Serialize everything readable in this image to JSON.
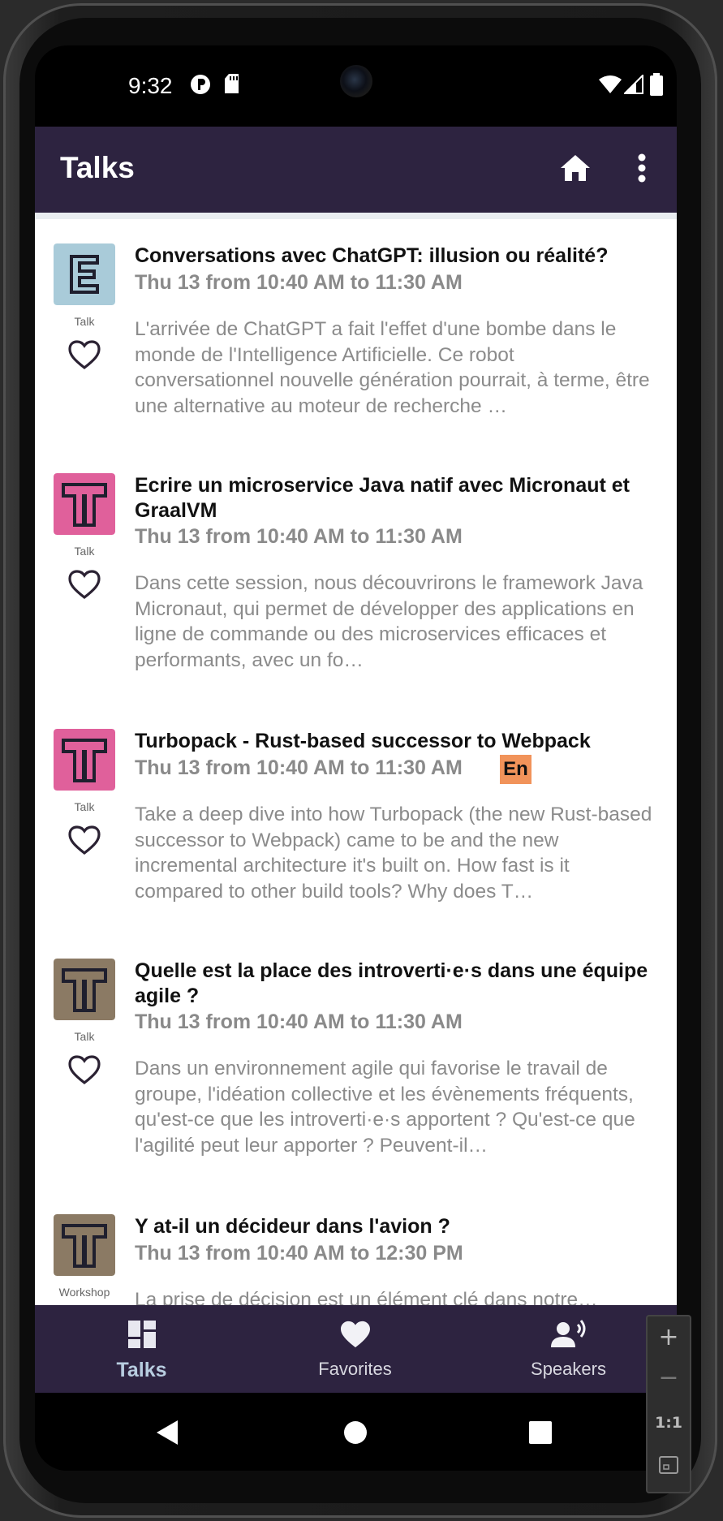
{
  "status_bar": {
    "time": "9:32"
  },
  "app_bar": {
    "title": "Talks"
  },
  "talks": [
    {
      "title": "Conversations avec ChatGPT: illusion ou réalité?",
      "time": "Thu 13 from 10:40 AM to 11:30 AM",
      "kind": "Talk",
      "icon_letter": "E",
      "icon_color": "#a9cbd9",
      "description": "L'arrivée de ChatGPT a fait l'effet d'une bombe dans le monde de l'Intelligence Artificielle. Ce robot conversationnel nouvelle génération pourrait, à terme, être une alternative au moteur de recherche …"
    },
    {
      "title": "Ecrire un microservice Java natif avec Micronaut et GraalVM",
      "time": "Thu 13 from 10:40 AM to 11:30 AM",
      "kind": "Talk",
      "icon_letter": "T",
      "icon_color": "#e0609b",
      "description": "Dans cette session, nous découvrirons le framework Java Micronaut, qui permet de développer des applications en ligne de commande ou des microservices efficaces et performants, avec un fo…"
    },
    {
      "title": "Turbopack - Rust-based successor to Webpack",
      "time": "Thu 13 from 10:40 AM to 11:30 AM",
      "kind": "Talk",
      "icon_letter": "T",
      "icon_color": "#e0609b",
      "language": "En",
      "description": "Take a deep dive into how Turbopack (the new Rust-based successor to Webpack) came to be and the new incremental architecture it's built on. How fast is it compared to other build tools? Why does T…"
    },
    {
      "title": "Quelle est la place des introverti·e·s dans une équipe agile ?",
      "time": "Thu 13 from 10:40 AM to 11:30 AM",
      "kind": "Talk",
      "icon_letter": "T",
      "icon_color": "#8b7a64",
      "description": "Dans un environnement agile qui favorise le travail de groupe, l'idéation collective et les évènements fréquents, qu'est-ce que les introverti·e·s apportent ? Qu'est-ce que l'agilité peut leur apporter ? Peuvent-il…"
    },
    {
      "title": "Y at-il un décideur dans l'avion ?",
      "time": "Thu 13 from 10:40 AM to 12:30 PM",
      "kind": "Workshop",
      "icon_letter": "T",
      "icon_color": "#8b7a64",
      "description": "La prise de décision est un élément clé dans notre…"
    }
  ],
  "bottom_nav": {
    "talks": "Talks",
    "favorites": "Favorites",
    "speakers": "Speakers"
  },
  "emulator_toolbar": {
    "zoom_in": "+",
    "zoom_out": "−",
    "ratio": "1:1"
  }
}
